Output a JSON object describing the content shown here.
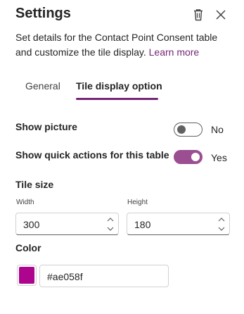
{
  "header": {
    "title": "Settings",
    "delete_icon": "trash-icon",
    "close_icon": "close-icon"
  },
  "description": {
    "text": "Set details for the Contact Point Consent table and customize the tile display. ",
    "link": "Learn more"
  },
  "tabs": [
    {
      "label": "General",
      "selected": false
    },
    {
      "label": "Tile display option",
      "selected": true
    }
  ],
  "show_picture": {
    "label": "Show picture",
    "on": false,
    "state_text": "No"
  },
  "show_quick_actions": {
    "label": "Show quick actions for this table",
    "on": true,
    "state_text": "Yes"
  },
  "tile_size": {
    "label": "Tile size",
    "width_label": "Width",
    "width_value": "300",
    "height_label": "Height",
    "height_value": "180"
  },
  "color": {
    "label": "Color",
    "value": "#ae058f",
    "swatch": "#ae058f"
  },
  "colors": {
    "accent": "#742774",
    "toggle_on": "#9b4e92"
  }
}
